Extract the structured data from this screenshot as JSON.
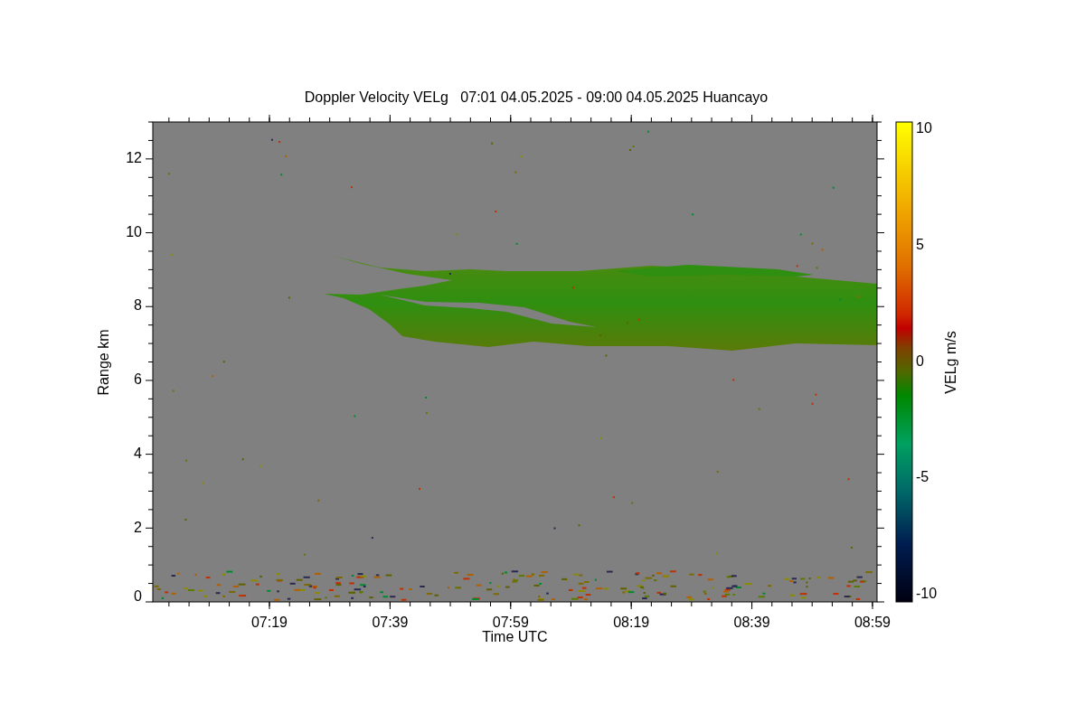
{
  "title": "Doppler Velocity VELg   07:01 04.05.2025 - 09:00 04.05.2025 Huancayo",
  "y_axis": {
    "label": "Range km",
    "ticks": [
      "12",
      "10",
      "8",
      "6",
      "4",
      "2",
      "0"
    ]
  },
  "x_axis": {
    "label": "Time UTC",
    "ticks": [
      "07:19",
      "07:39",
      "07:59",
      "08:19",
      "08:39",
      "08:59"
    ]
  },
  "colorbar": {
    "label": "VELg m/s",
    "ticks": [
      "10",
      "5",
      "0",
      "-5",
      "-10"
    ]
  }
}
